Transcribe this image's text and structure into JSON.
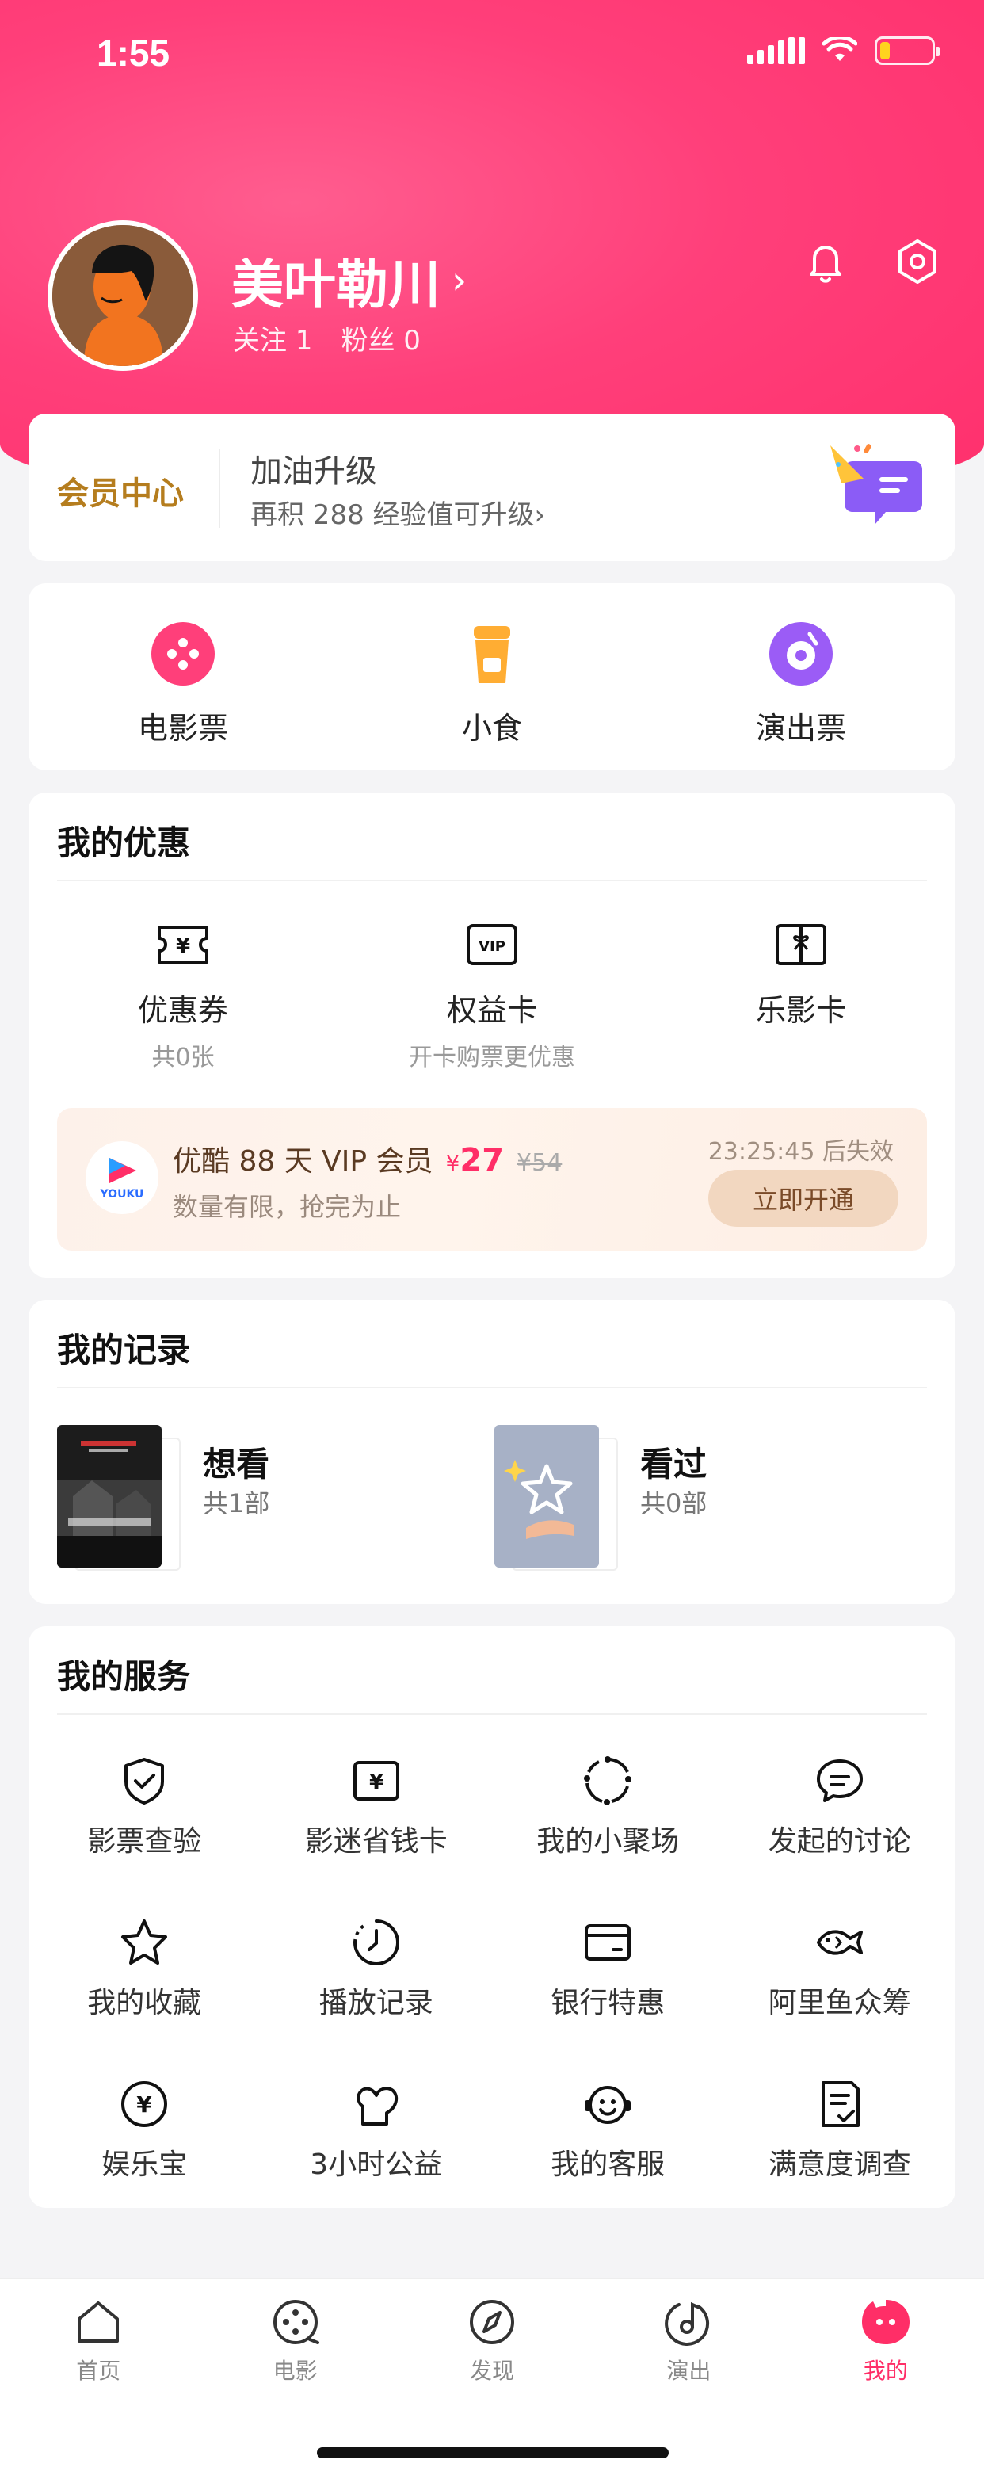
{
  "status_bar": {
    "time": "1:55",
    "battery_level": 0.2,
    "battery_color": "#ffd21f"
  },
  "profile": {
    "username": "美叶勒川",
    "chevron": "›",
    "following_label": "关注 1",
    "fans_label": "粉丝 0"
  },
  "icons": {
    "notifications": "bell-icon",
    "settings": "settings-hexagon-icon"
  },
  "member": {
    "title": "会员中心",
    "level_text": "加油升级",
    "hint": "再积 288 经验值可升级›"
  },
  "quick_links": [
    {
      "label": "电影票",
      "icon": "film-reel-icon",
      "color": "#ff3f7a"
    },
    {
      "label": "小食",
      "icon": "drink-cup-icon",
      "color": "#ffad33"
    },
    {
      "label": "演出票",
      "icon": "music-disc-icon",
      "color": "#9b5cf6"
    }
  ],
  "discounts": {
    "title": "我的优惠",
    "items": [
      {
        "label": "优惠券",
        "sub": "共0张",
        "icon": "coupon-icon"
      },
      {
        "label": "权益卡",
        "sub": "开卡购票更优惠",
        "icon": "vip-card-icon"
      },
      {
        "label": "乐影卡",
        "sub": "",
        "icon": "gift-card-icon"
      }
    ],
    "promo": {
      "brand": "YOUKU",
      "title": "优酷 88 天 VIP 会员",
      "price_symbol": "¥",
      "price": "27",
      "original_price": "¥54",
      "subtitle": "数量有限，抢完为止",
      "timer": "23:25:45 后失效",
      "button": "立即开通"
    }
  },
  "records": {
    "title": "我的记录",
    "items": [
      {
        "label": "想看",
        "count": "共1部"
      },
      {
        "label": "看过",
        "count": "共0部"
      }
    ]
  },
  "services": {
    "title": "我的服务",
    "items": [
      {
        "label": "影票查验",
        "icon": "shield-check-icon"
      },
      {
        "label": "影迷省钱卡",
        "icon": "yen-card-icon"
      },
      {
        "label": "我的小聚场",
        "icon": "circle-dots-icon"
      },
      {
        "label": "发起的讨论",
        "icon": "chat-bubble-icon"
      },
      {
        "label": "我的收藏",
        "icon": "star-icon"
      },
      {
        "label": "播放记录",
        "icon": "clock-icon"
      },
      {
        "label": "银行特惠",
        "icon": "bank-card-icon"
      },
      {
        "label": "阿里鱼众筹",
        "icon": "fish-icon"
      },
      {
        "label": "娱乐宝",
        "icon": "yen-coin-icon"
      },
      {
        "label": "3小时公益",
        "icon": "charity-heart-icon"
      },
      {
        "label": "我的客服",
        "icon": "headset-smile-icon"
      },
      {
        "label": "满意度调查",
        "icon": "survey-icon"
      }
    ]
  },
  "tabbar": {
    "active_color": "#ff2e67",
    "tabs": [
      {
        "label": "首页",
        "icon": "home-icon"
      },
      {
        "label": "电影",
        "icon": "film-reel-icon"
      },
      {
        "label": "发现",
        "icon": "compass-icon"
      },
      {
        "label": "演出",
        "icon": "music-note-icon"
      },
      {
        "label": "我的",
        "icon": "profile-face-icon"
      }
    ]
  }
}
